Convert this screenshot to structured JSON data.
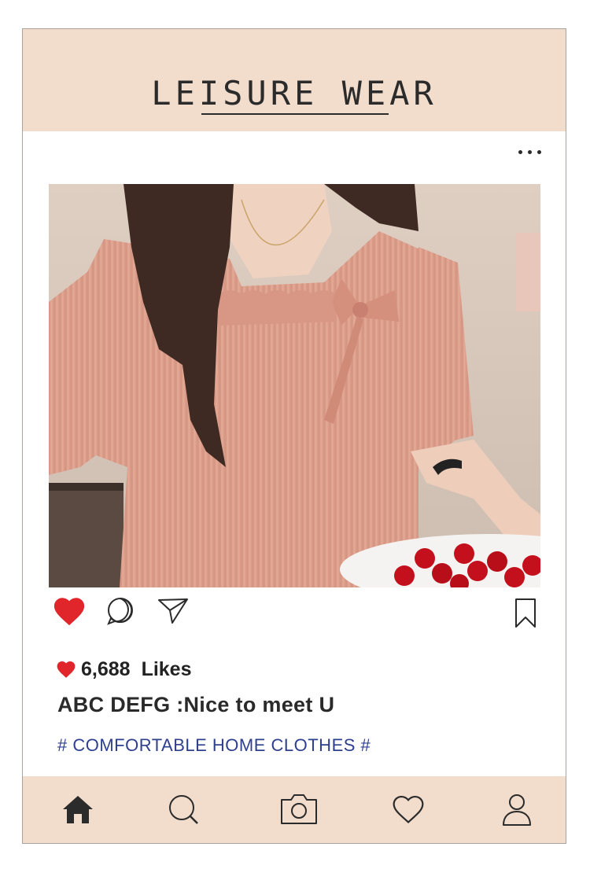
{
  "header": {
    "title": "LEISURE WEAR"
  },
  "post": {
    "more_icon": "more-horizontal-icon",
    "photo_description_icon": "product-photo",
    "actions": {
      "like_icon": "heart-filled-icon",
      "comment_icon": "comment-bubble-icon",
      "share_icon": "send-paper-plane-icon",
      "save_icon": "bookmark-icon"
    },
    "likes": {
      "count": "6,688",
      "label": "Likes"
    },
    "caption": "ABC DEFG :Nice to meet U",
    "hashtag": "# COMFORTABLE HOME CLOTHES #"
  },
  "nav": {
    "items": [
      {
        "icon": "home-icon"
      },
      {
        "icon": "search-icon"
      },
      {
        "icon": "camera-icon"
      },
      {
        "icon": "heart-outline-icon"
      },
      {
        "icon": "profile-icon"
      }
    ]
  },
  "colors": {
    "accent_peach": "#f2dccb",
    "like_red": "#e0262a",
    "hashtag_blue": "#2e3f8e",
    "text_dark": "#2b2b2b"
  }
}
